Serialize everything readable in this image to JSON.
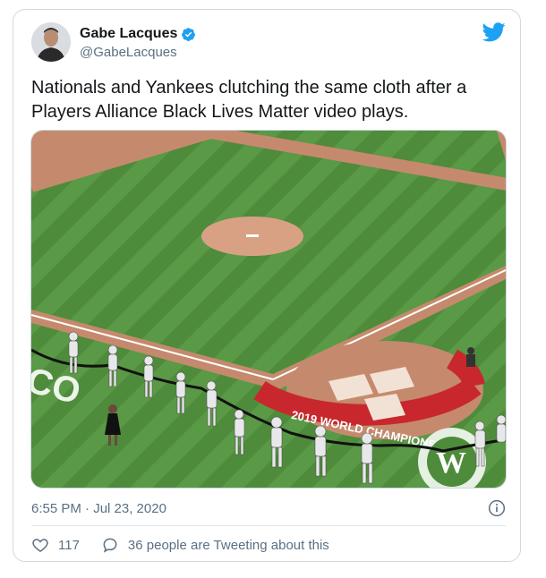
{
  "author": {
    "display_name": "Gabe Lacques",
    "handle": "@GabeLacques",
    "verified": true
  },
  "tweet": {
    "text": "Nationals and Yankees clutching the same cloth after a Players Alliance Black Lives Matter video plays.",
    "timestamp": "6:55 PM · Jul 23, 2020"
  },
  "media": {
    "field_banner_text": "2019 WORLD CHAMPIONS",
    "wall_text": "CO"
  },
  "actions": {
    "likes": "117",
    "conversation": "36 people are Tweeting about this"
  },
  "colors": {
    "twitter_blue": "#1da1f2",
    "grass": "#4d8a3a",
    "dirt": "#c9876a",
    "banner_red": "#c8282d"
  }
}
